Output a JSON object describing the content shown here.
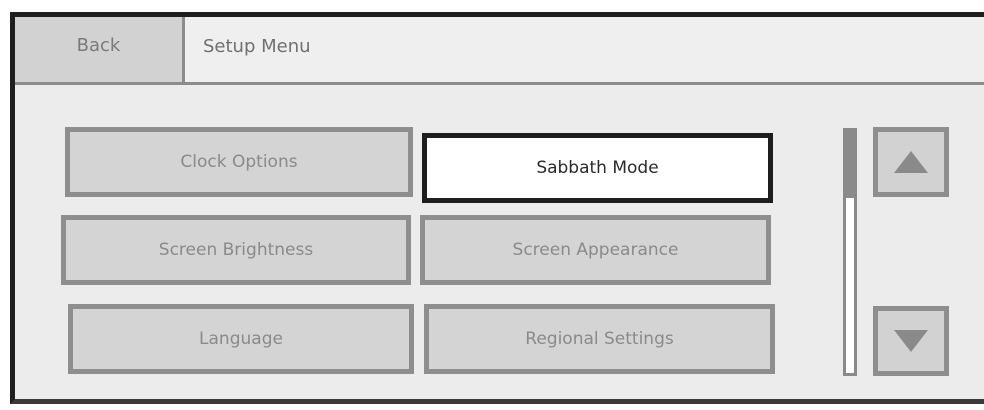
{
  "header": {
    "back_label": "Back",
    "title": "Setup Menu"
  },
  "options": [
    {
      "label": "Clock Options",
      "selected": false
    },
    {
      "label": "Sabbath Mode",
      "selected": true
    },
    {
      "label": "Screen Brightness",
      "selected": false
    },
    {
      "label": "Screen Appearance",
      "selected": false
    },
    {
      "label": "Language",
      "selected": false
    },
    {
      "label": "Regional Settings",
      "selected": false
    }
  ],
  "scroll": {
    "up_icon": "triangle-up-icon",
    "down_icon": "triangle-down-icon"
  },
  "colors": {
    "panel_background": "#ececec",
    "button_fill": "#d4d4d4",
    "button_border": "#8e8e8e",
    "selected_border": "#1e1e1e",
    "selected_fill": "#ffffff"
  }
}
